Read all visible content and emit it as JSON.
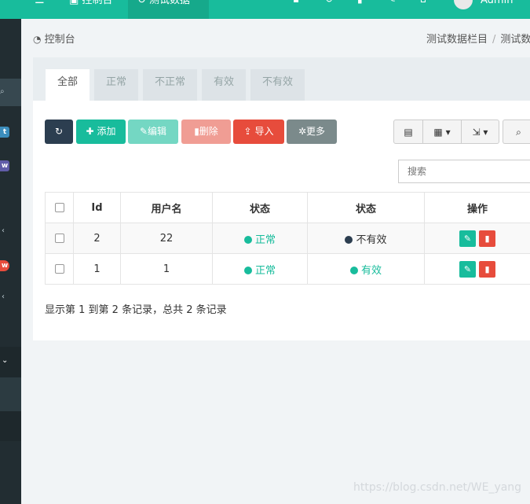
{
  "topbar": {
    "menu_icon": "menu-icon",
    "item_1": "控制台",
    "item_1_icon": "dashboard-icon",
    "item_2": "测试数据",
    "item_2_icon": "refresh-icon",
    "icons": [
      "home-icon",
      "refresh-icon",
      "trash-icon",
      "translate-icon",
      "house-icon"
    ],
    "user": "Admin",
    "brand_color": "#18bc9c"
  },
  "breadcrumb": {
    "left": "控制台",
    "left_icon": "dashboard-icon",
    "right_1": "测试数据栏目",
    "sep": "/",
    "right_2": "测试数"
  },
  "tabs": [
    "全部",
    "正常",
    "不正常",
    "有效",
    "不有效"
  ],
  "toolbar": {
    "refresh_icon": "refresh-icon",
    "add": "添加",
    "edit": "编辑",
    "delete": "删除",
    "import": "导入",
    "more": "更多"
  },
  "search": {
    "placeholder": "搜索"
  },
  "table": {
    "headers": [
      "Id",
      "用户名",
      "状态",
      "状态",
      "操作"
    ],
    "rows": [
      {
        "id": "2",
        "username": "22",
        "status1": "正常",
        "status2": "不有效"
      },
      {
        "id": "1",
        "username": "1",
        "status1": "正常",
        "status2": "有效"
      }
    ]
  },
  "summary": "显示第 1 到第 2 条记录，总共 2 条记录",
  "watermark": "https://blog.csdn.net/WE_yang",
  "colors": {
    "green": "#18bc9c",
    "red": "#e74c3c",
    "dark": "#2c3e50",
    "gray": "#7b8a8b"
  }
}
